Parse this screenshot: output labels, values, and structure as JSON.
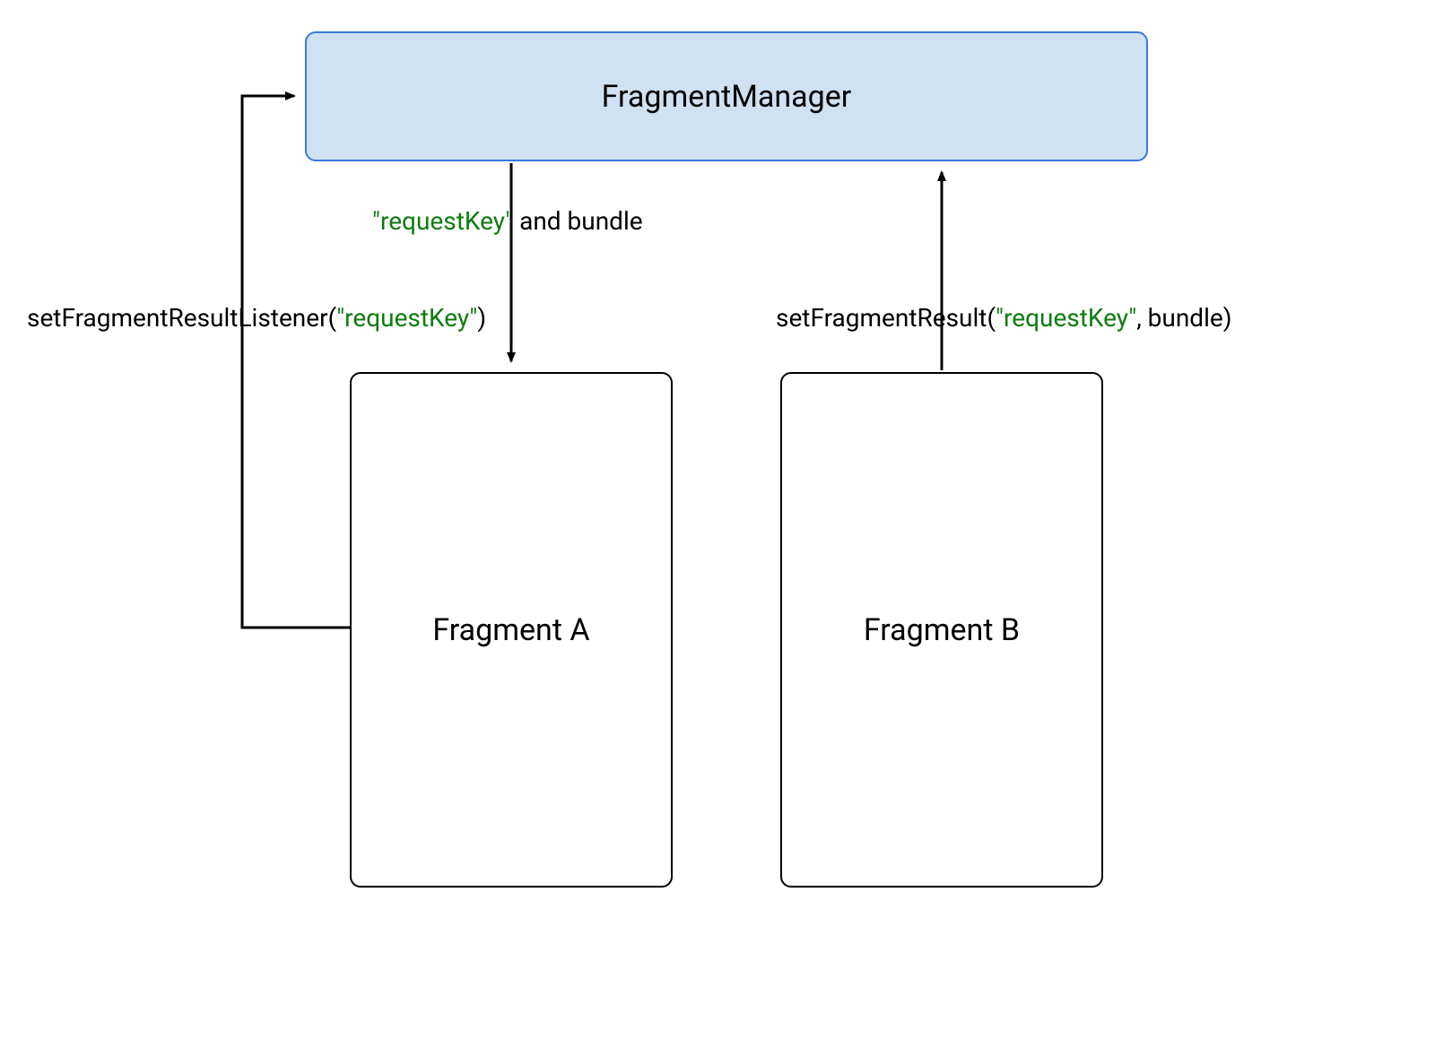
{
  "boxes": {
    "manager": {
      "label": "FragmentManager"
    },
    "fragmentA": {
      "label": "Fragment A"
    },
    "fragmentB": {
      "label": "Fragment B"
    }
  },
  "annotations": {
    "listener": {
      "prefix": "setFragmentResultListener(",
      "literal": "\"requestKey\"",
      "suffix": ")"
    },
    "bundleDown": {
      "literal": "\"requestKey\"",
      "suffix": " and bundle"
    },
    "setResult": {
      "prefix": "setFragmentResult(",
      "literal": "\"requestKey\"",
      "suffix": ", bundle)"
    }
  }
}
